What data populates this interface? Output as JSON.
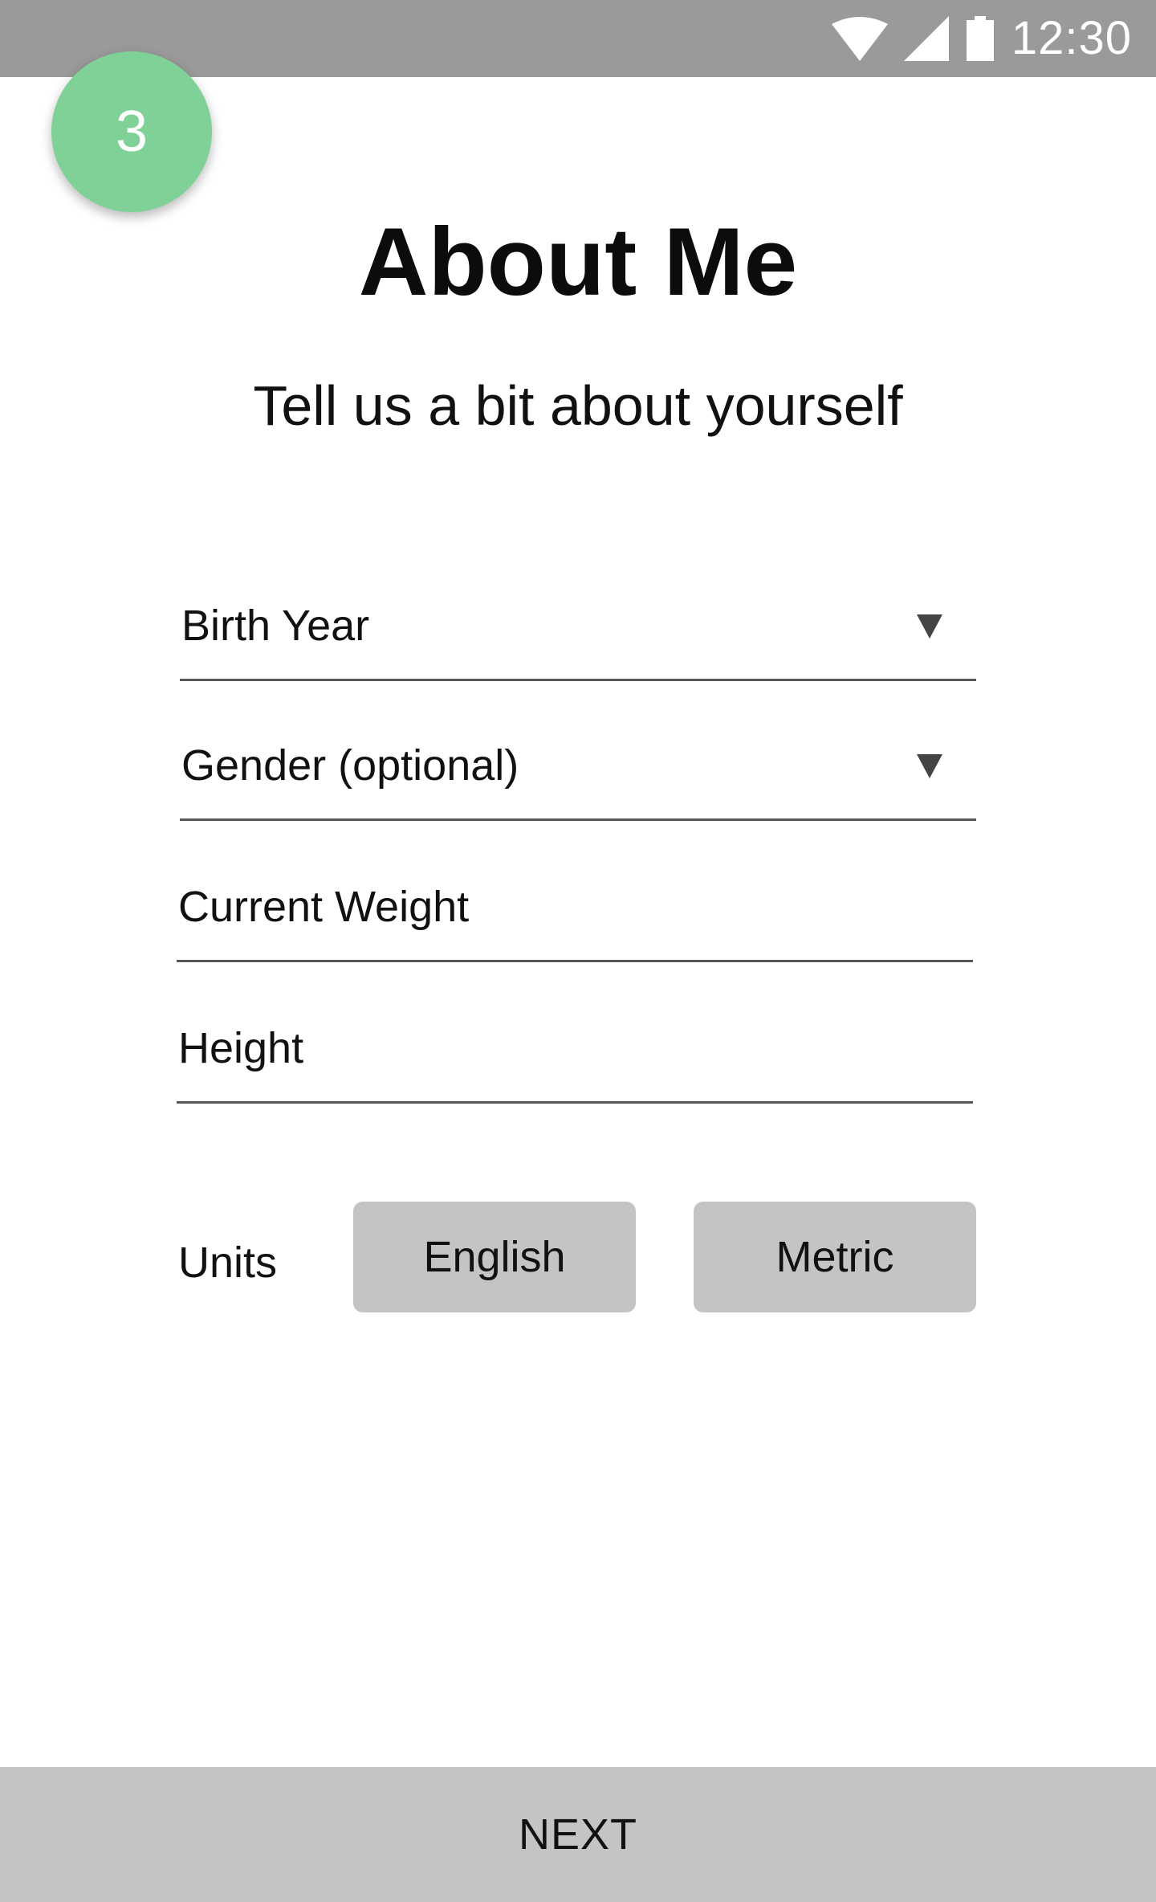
{
  "status_bar": {
    "time": "12:30",
    "icons": [
      "wifi-icon",
      "cellular-signal-icon",
      "battery-icon"
    ],
    "background": "#9a9a9a"
  },
  "step": {
    "number": "3",
    "color": "#7fd197"
  },
  "header": {
    "title": "About Me",
    "subtitle": "Tell us a bit about yourself"
  },
  "form": {
    "birth_year": {
      "placeholder": "Birth Year",
      "type": "dropdown"
    },
    "gender": {
      "placeholder": "Gender (optional)",
      "type": "dropdown"
    },
    "current_weight": {
      "placeholder": "Current Weight",
      "type": "text"
    },
    "height": {
      "placeholder": "Height",
      "type": "text"
    }
  },
  "units": {
    "label": "Units",
    "options": [
      "English",
      "Metric"
    ]
  },
  "footer": {
    "next_label": "NEXT"
  }
}
